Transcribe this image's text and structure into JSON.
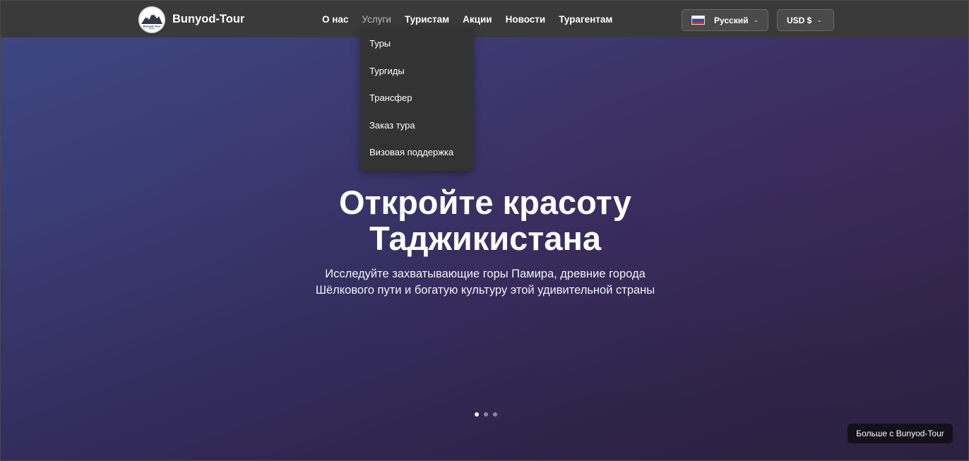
{
  "header": {
    "brand": "Bunyod-Tour",
    "nav": [
      {
        "label": "О нас"
      },
      {
        "label": "Услуги"
      },
      {
        "label": "Туристам"
      },
      {
        "label": "Акции"
      },
      {
        "label": "Новости"
      },
      {
        "label": "Турагентам"
      }
    ],
    "language": {
      "label": "Русский",
      "flag_icon": "russia-flag-icon"
    },
    "currency": {
      "label": "USD $"
    }
  },
  "services_dropdown": {
    "items": [
      {
        "label": "Туры"
      },
      {
        "label": "Тургиды"
      },
      {
        "label": "Трансфер"
      },
      {
        "label": "Заказ тура"
      },
      {
        "label": "Визовая поддержка"
      }
    ]
  },
  "hero": {
    "title_line1": "Откройте красоту",
    "title_line2": "Таджикистана",
    "subtitle_line1": "Исследуйте захватывающие горы Памира, древние города",
    "subtitle_line2": "Шёлкового пути и богатую культуру этой удивительной страны",
    "slides_count": 3,
    "active_slide": 1,
    "more_button": "Больше с Bunyod-Tour"
  },
  "colors": {
    "header_bg": "#3a3a3a",
    "dropdown_bg": "#333333",
    "hero_gradient_start": "#3d4682",
    "hero_gradient_end": "#2b2140"
  }
}
